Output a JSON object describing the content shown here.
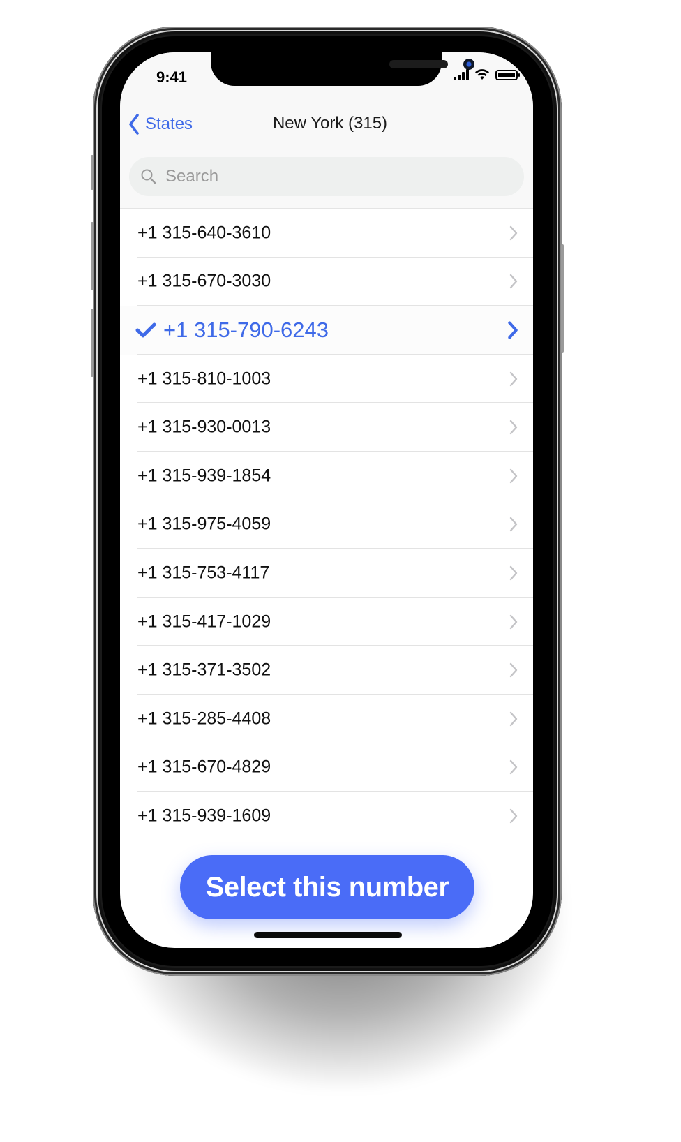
{
  "status_bar": {
    "time": "9:41",
    "signal_icon": "cellular-signal-icon",
    "wifi_icon": "wifi-icon",
    "battery_icon": "battery-icon"
  },
  "nav": {
    "back_label": "States",
    "back_icon": "chevron-left-icon",
    "title": "New York (315)"
  },
  "search": {
    "placeholder": "Search",
    "value": "",
    "icon": "search-icon"
  },
  "colors": {
    "accent": "#3f6ae8",
    "button": "#4a6cf7",
    "text": "#111111",
    "chevron": "#c4c4c7"
  },
  "numbers": [
    {
      "label": "+1 315-640-3610",
      "selected": false
    },
    {
      "label": "+1 315-670-3030",
      "selected": false
    },
    {
      "label": "+1 315-790-6243",
      "selected": true
    },
    {
      "label": "+1 315-810-1003",
      "selected": false
    },
    {
      "label": "+1 315-930-0013",
      "selected": false
    },
    {
      "label": "+1 315-939-1854",
      "selected": false
    },
    {
      "label": "+1 315-975-4059",
      "selected": false
    },
    {
      "label": "+1 315-753-4117",
      "selected": false
    },
    {
      "label": "+1 315-417-1029",
      "selected": false
    },
    {
      "label": "+1 315-371-3502",
      "selected": false
    },
    {
      "label": "+1 315-285-4408",
      "selected": false
    },
    {
      "label": "+1 315-670-4829",
      "selected": false
    },
    {
      "label": "+1 315-939-1609",
      "selected": false
    }
  ],
  "cta": {
    "label": "Select this number"
  }
}
